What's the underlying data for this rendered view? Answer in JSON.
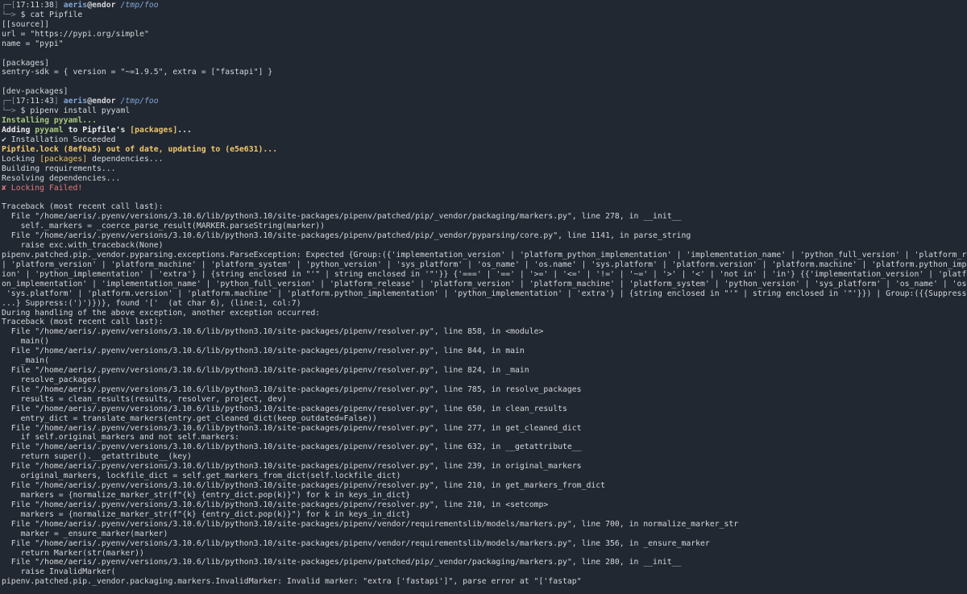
{
  "prompt1": {
    "time": "17:11:38",
    "user": "aeris",
    "at": "@",
    "host": "endor",
    "path": "/tmp/foo",
    "command": "cat Pipfile"
  },
  "pipfile": [
    "[[source]]",
    "url = \"https://pypi.org/simple\"",
    "name = \"pypi\"",
    "",
    "[packages]",
    "sentry-sdk = { version = \"~=1.9.5\", extra = [\"fastapi\"] }",
    "",
    "[dev-packages]"
  ],
  "prompt2": {
    "time": "17:11:43",
    "user": "aeris",
    "at": "@",
    "host": "endor",
    "path": "/tmp/foo",
    "command": "pipenv install pyyaml"
  },
  "install": {
    "installing": "Installing pyyaml...",
    "adding_pre": "Adding ",
    "adding_pkg": "pyyaml",
    "adding_mid": " to Pipfile's ",
    "adding_section": "[packages]",
    "adding_post": "...",
    "succeeded": "✔ Installation Succeeded",
    "lock_outdated": "Pipfile.lock (8ef0a5) out of date, updating to (e5e631)...",
    "locking_pre": "Locking ",
    "locking_section": "[packages]",
    "locking_post": " dependencies...",
    "building": "Building requirements...",
    "resolving": "Resolving dependencies...",
    "failed": "✘ Locking Failed!"
  },
  "traceback": [
    "",
    "Traceback (most recent call last):",
    "  File \"/home/aeris/.pyenv/versions/3.10.6/lib/python3.10/site-packages/pipenv/patched/pip/_vendor/packaging/markers.py\", line 278, in __init__",
    "    self._markers = _coerce_parse_result(MARKER.parseString(marker))",
    "  File \"/home/aeris/.pyenv/versions/3.10.6/lib/python3.10/site-packages/pipenv/patched/pip/_vendor/pyparsing/core.py\", line 1141, in parse_string",
    "    raise exc.with_traceback(None)",
    "pipenv.patched.pip._vendor.pyparsing.exceptions.ParseException: Expected {Group:({'implementation_version' | 'platform_python_implementation' | 'implementation_name' | 'python_full_version' | 'platform_release'",
    "| 'platform_version' | 'platform_machine' | 'platform_system' | 'python_version' | 'sys_platform' | 'os_name' | 'os.name' | 'sys.platform' | 'platform.version' | 'platform.machine' | 'platform.python_implementat",
    "ion' | 'python_implementation' | 'extra'} | {string enclosed in \"'\" | string enclosed in '\"'}} {'===' | '==' | '>=' | '<=' | '!=' | '~=' | '>' | '<' | 'not in' | 'in'} {{'implementation_version' | 'platform_pyth",
    "on_implementation' | 'implementation_name' | 'python_full_version' | 'platform_release' | 'platform_version' | 'platform_machine' | 'platform_system' | 'python_version' | 'sys_platform' | 'os_name' | 'os.name' |",
    " 'sys.platform' | 'platform.version' | 'platform.machine' | 'platform.python_implementation' | 'python_implementation' | 'extra'} | {string enclosed in \"'\" | string enclosed in '\"'}}) | Group:({{Suppress:('(') :",
    "...} Suppress:(')')})}, found '['  (at char 6), (line:1, col:7)",
    "During handling of the above exception, another exception occurred:",
    "Traceback (most recent call last):",
    "  File \"/home/aeris/.pyenv/versions/3.10.6/lib/python3.10/site-packages/pipenv/resolver.py\", line 858, in <module>",
    "    main()",
    "  File \"/home/aeris/.pyenv/versions/3.10.6/lib/python3.10/site-packages/pipenv/resolver.py\", line 844, in main",
    "    _main(",
    "  File \"/home/aeris/.pyenv/versions/3.10.6/lib/python3.10/site-packages/pipenv/resolver.py\", line 824, in _main",
    "    resolve_packages(",
    "  File \"/home/aeris/.pyenv/versions/3.10.6/lib/python3.10/site-packages/pipenv/resolver.py\", line 785, in resolve_packages",
    "    results = clean_results(results, resolver, project, dev)",
    "  File \"/home/aeris/.pyenv/versions/3.10.6/lib/python3.10/site-packages/pipenv/resolver.py\", line 650, in clean_results",
    "    entry_dict = translate_markers(entry.get_cleaned_dict(keep_outdated=False))",
    "  File \"/home/aeris/.pyenv/versions/3.10.6/lib/python3.10/site-packages/pipenv/resolver.py\", line 277, in get_cleaned_dict",
    "    if self.original_markers and not self.markers:",
    "  File \"/home/aeris/.pyenv/versions/3.10.6/lib/python3.10/site-packages/pipenv/resolver.py\", line 632, in __getattribute__",
    "    return super().__getattribute__(key)",
    "  File \"/home/aeris/.pyenv/versions/3.10.6/lib/python3.10/site-packages/pipenv/resolver.py\", line 239, in original_markers",
    "    original_markers, lockfile_dict = self.get_markers_from_dict(self.lockfile_dict)",
    "  File \"/home/aeris/.pyenv/versions/3.10.6/lib/python3.10/site-packages/pipenv/resolver.py\", line 210, in get_markers_from_dict",
    "    markers = {normalize_marker_str(f\"{k} {entry_dict.pop(k)}\") for k in keys_in_dict}",
    "  File \"/home/aeris/.pyenv/versions/3.10.6/lib/python3.10/site-packages/pipenv/resolver.py\", line 210, in <setcomp>",
    "    markers = {normalize_marker_str(f\"{k} {entry_dict.pop(k)}\") for k in keys_in_dict}",
    "  File \"/home/aeris/.pyenv/versions/3.10.6/lib/python3.10/site-packages/pipenv/vendor/requirementslib/models/markers.py\", line 700, in normalize_marker_str",
    "    marker = _ensure_marker(marker)",
    "  File \"/home/aeris/.pyenv/versions/3.10.6/lib/python3.10/site-packages/pipenv/vendor/requirementslib/models/markers.py\", line 356, in _ensure_marker",
    "    return Marker(str(marker))",
    "  File \"/home/aeris/.pyenv/versions/3.10.6/lib/python3.10/site-packages/pipenv/patched/pip/_vendor/packaging/markers.py\", line 280, in __init__",
    "    raise InvalidMarker(",
    "pipenv.patched.pip._vendor.packaging.markers.InvalidMarker: Invalid marker: \"extra ['fastapi']\", parse error at \"['fastap\""
  ],
  "colors": {
    "background": "#222831",
    "text": "#d4d7dc",
    "user": "#7fa7d8",
    "green": "#a9c97f",
    "yellow": "#f2c86b",
    "red": "#e07a7a"
  }
}
